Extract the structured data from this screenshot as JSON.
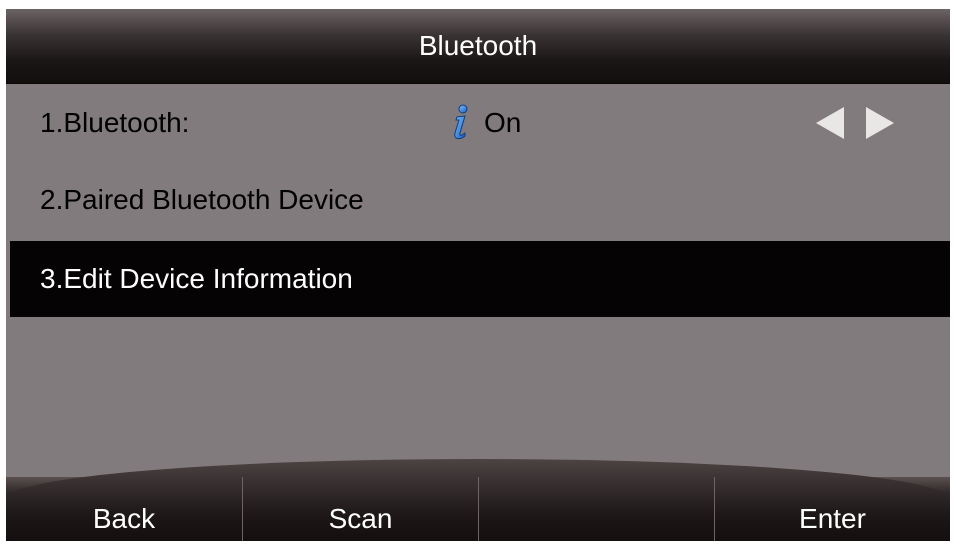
{
  "title": "Bluetooth",
  "menu": {
    "items": [
      {
        "label": "1.Bluetooth:",
        "value": "On",
        "selected": false
      },
      {
        "label": "2.Paired Bluetooth Device",
        "selected": false
      },
      {
        "label": "3.Edit Device Information",
        "selected": true
      }
    ]
  },
  "softkeys": [
    "Back",
    "Scan",
    "",
    "Enter"
  ],
  "icons": {
    "info": "info-icon",
    "left": "arrow-left-icon",
    "right": "arrow-right-icon"
  },
  "colors": {
    "selected_row": "#050303",
    "screen_background": "#827b7d",
    "info_icon": "#1a66c8"
  }
}
